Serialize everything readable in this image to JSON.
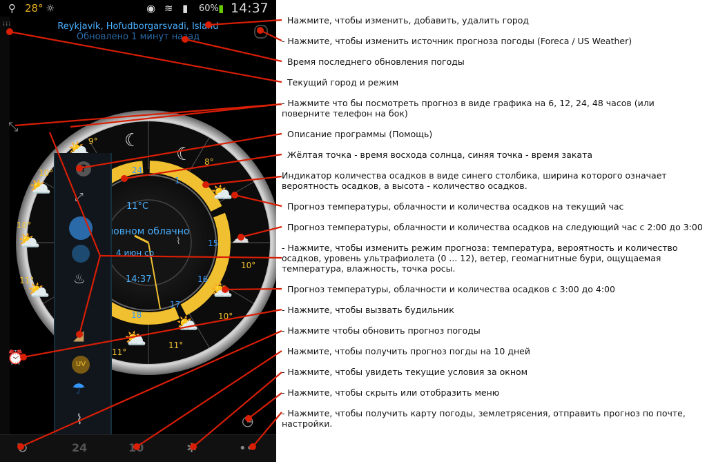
{
  "status_bar": {
    "usb_icon": "usb-icon",
    "temperature": "28°",
    "weather_icon": "sun-icon",
    "battery": "60%",
    "time": "14:37"
  },
  "header": {
    "city": "Reykjavík, Hofudborgarsvadi, Island",
    "updated": "Обновлено 1 минут назад"
  },
  "dial": {
    "current_temp": "11°C",
    "condition": "новном облачно",
    "sunrise_date": "4 июн ср",
    "clock_time": "14:37",
    "hour_labels": [
      "24",
      "1",
      "15",
      "16",
      "17",
      "18"
    ],
    "outer_temps": [
      "9°",
      "8°",
      "10°",
      "10°",
      "10°",
      "11°",
      "10°",
      "11°",
      "11°",
      "11°"
    ]
  },
  "side_menu": {
    "icons": [
      "help-icon",
      "resize-icon",
      "forecast-mode-icon",
      "precip-icon",
      "feels-like-icon",
      "wind-icon",
      "uv-icon",
      "umbrella-icon",
      "thermometer-icon"
    ]
  },
  "bottom_bar": {
    "refresh_icon": "refresh-icon",
    "label_24": "24",
    "label_10": "10",
    "outside_icon": "puzzle-icon",
    "menu_icon": "dots-icon"
  },
  "annotations": [
    "Нажмите, чтобы изменить, добавить, удалить город",
    "- Нажмите, чтобы изменить источник прогноза погоды (Foreca / US Weather)",
    "Время последнего обновления погоды",
    "Текущий город и режим",
    "- Нажмите что бы посмотреть  прогноз в виде графика на 6, 12, 24, 48 часов (или поверните телефон на бок)",
    "Описание программы (Помощь)",
    "Жёлтая точка - время восхода солнца, синяя точка - время заката",
    "Индикатор количества осадков в виде синего столбика, ширина которого означает вероятность осадков, а высота - количество осадков.",
    "Прогноз температуры, облачности и количества осадков на текущий час",
    "Прогноз температуры, облачности и количества осадков на следующий час с 2:00 до 3:00",
    "- Нажмите, чтобы изменить режим прогноза: температура, вероятность и количество осадков, уровень ультрафиолета (0 ... 12), ветер, геомагнитные бури, ощущаемая температура, влажность, точка росы.",
    "Прогноз температуры, облачности и количества  осадков с 3:00 до 4:00",
    "- Нажмите, чтобы вызвать будильник",
    "- Нажмите чтобы обновить прогноз погоды",
    "Нажмите, чтобы получить прогноз погды  на 10 дней",
    "- Нажмите, чтобы увидеть текущие условия за окном",
    "- Нажмите, чтобы скрыть или отобразить меню",
    "- Нажмите, чтобы получить  карту погоды, землетрясения,  отправить прогноз по почте, настройки."
  ]
}
